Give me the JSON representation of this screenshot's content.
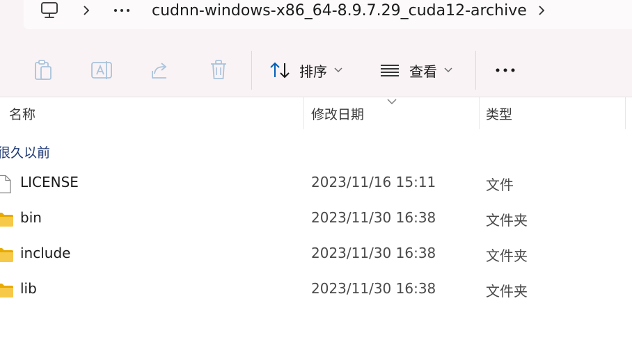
{
  "address": {
    "root_icon": "this-pc-icon",
    "separator_icon": "chevron-right-icon",
    "more_icon": "ellipsis-icon",
    "current_folder": "cudnn-windows-x86_64-8.9.7.29_cuda12-archive"
  },
  "toolbar": {
    "copy_icon": "clipboard-icon",
    "rename_icon": "rename-icon",
    "share_icon": "share-icon",
    "delete_icon": "trash-icon",
    "sort_label": "排序",
    "view_label": "查看",
    "more_icon": "ellipsis-icon"
  },
  "columns": {
    "name": "名称",
    "date": "修改日期",
    "type": "类型"
  },
  "group": {
    "title": "很久以前"
  },
  "files": [
    {
      "name": "LICENSE",
      "date": "2023/11/16 15:11",
      "type": "文件",
      "icon": "file-icon"
    },
    {
      "name": "bin",
      "date": "2023/11/30 16:38",
      "type": "文件夹",
      "icon": "folder-icon"
    },
    {
      "name": "include",
      "date": "2023/11/30 16:38",
      "type": "文件夹",
      "icon": "folder-icon"
    },
    {
      "name": "lib",
      "date": "2023/11/30 16:38",
      "type": "文件夹",
      "icon": "folder-icon"
    }
  ],
  "colors": {
    "chrome_bg": "#f9f3f5",
    "accent": "#005fb8",
    "group_title": "#1f3a73",
    "disabled_icon": "#a9c3dc",
    "folder": "#f7c948"
  }
}
